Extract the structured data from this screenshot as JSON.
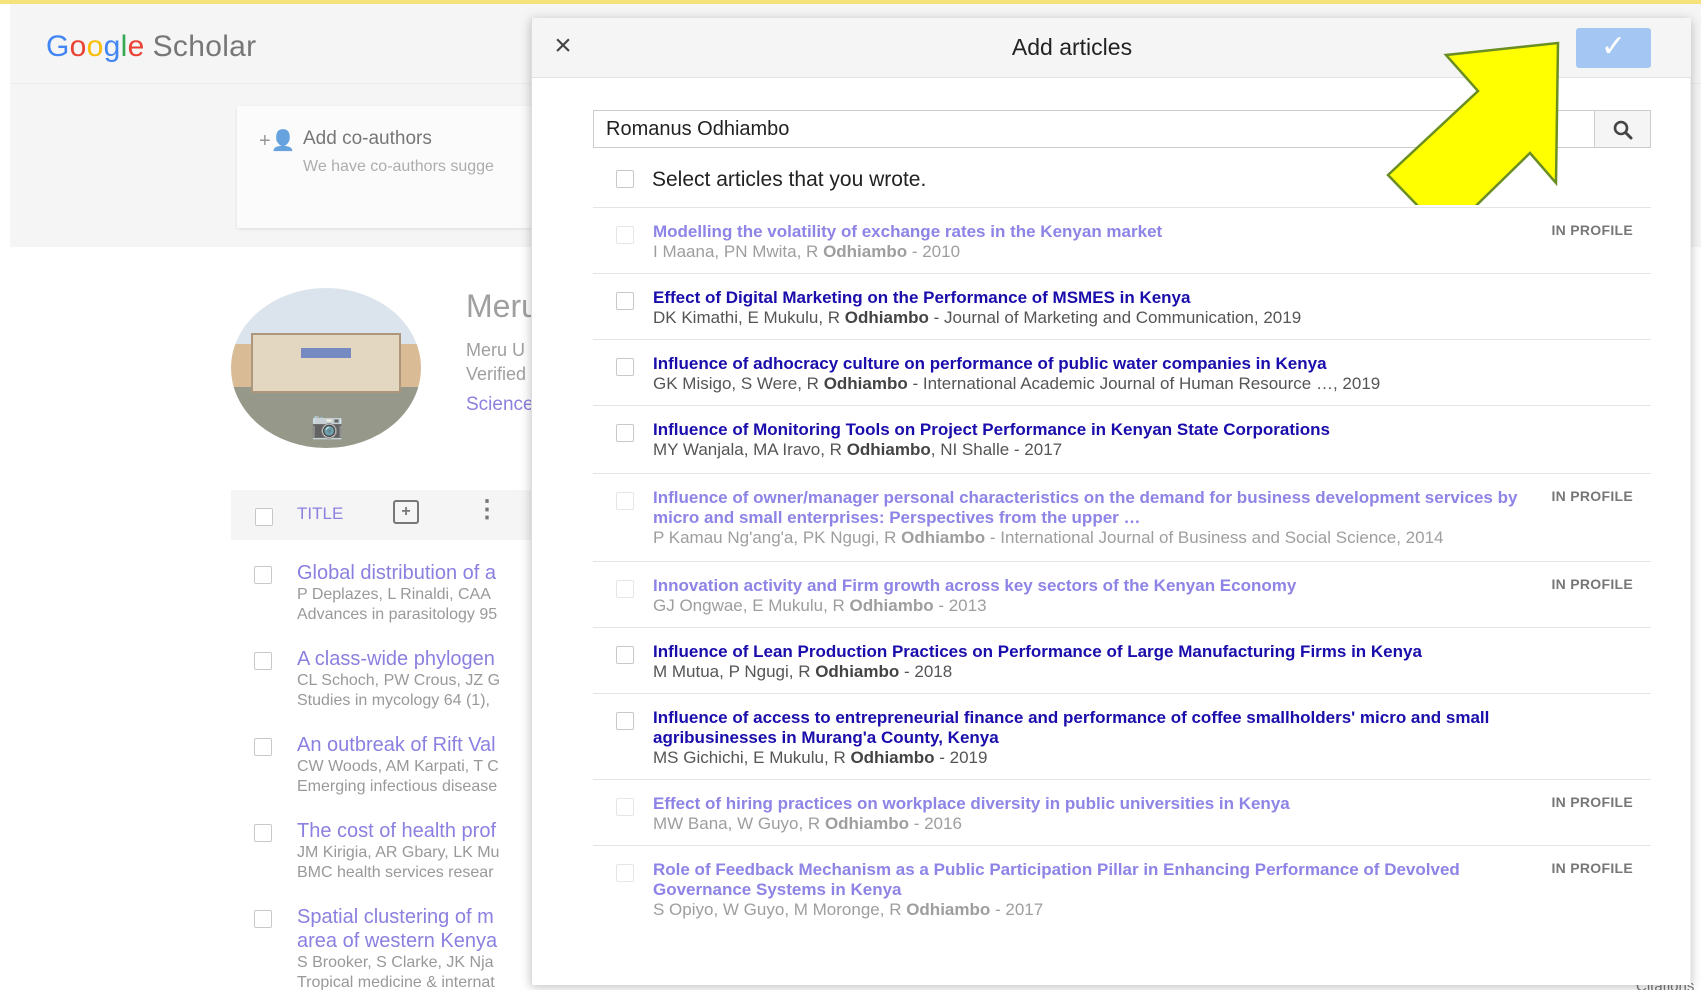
{
  "background": {
    "logo_google": "Google",
    "logo_scholar": "Scholar",
    "coauthors": {
      "title": "Add co-authors",
      "subtitle": "We have co-authors sugge"
    },
    "profile": {
      "name": "Meru",
      "line1": "Meru U",
      "line2": "Verified",
      "link": "Science"
    },
    "table_header": {
      "title_label": "TITLE"
    },
    "articles": [
      {
        "title": "Global distribution of a",
        "authors": "P Deplazes, L Rinaldi, CAA",
        "venue": "Advances in parasitology 95"
      },
      {
        "title": "A class-wide phylogen",
        "authors": "CL Schoch, PW Crous, JZ G",
        "venue": "Studies in mycology 64 (1),"
      },
      {
        "title": "An outbreak of Rift Val",
        "authors": "CW Woods, AM Karpati, T C",
        "venue": "Emerging infectious disease"
      },
      {
        "title": "The cost of health prof",
        "authors": "JM Kirigia, AR Gbary, LK Mu",
        "venue": "BMC health services resear"
      },
      {
        "title": "Spatial clustering of m",
        "title2": "area of western Kenya",
        "authors": "S Brooker, S Clarke, JK Nja",
        "venue": "Tropical medicine & internat"
      }
    ],
    "bottom_right": "Citations"
  },
  "modal": {
    "title": "Add articles",
    "search": {
      "value": "Romanus Odhiambo"
    },
    "select_label": "Select articles that you wrote.",
    "in_profile_label": "IN PROFILE",
    "rows": [
      {
        "title": "Modelling the volatility of exchange rates in the Kenyan market",
        "pre": "I Maana, PN Mwita, R ",
        "bold": "Odhiambo",
        "post": " - 2010",
        "in_profile": true
      },
      {
        "title": "Effect of Digital Marketing on the Performance of MSMES in Kenya",
        "pre": "DK Kimathi, E Mukulu, R ",
        "bold": "Odhiambo",
        "post": " - Journal of Marketing and Communication, 2019",
        "in_profile": false
      },
      {
        "title": "Influence of adhocracy culture on performance of public water companies in Kenya",
        "pre": "GK Misigo, S Were, R ",
        "bold": "Odhiambo",
        "post": " - International Academic Journal of Human Resource …, 2019",
        "in_profile": false
      },
      {
        "title": "Influence of Monitoring Tools on Project Performance in Kenyan State Corporations",
        "pre": "MY Wanjala, MA Iravo, R ",
        "bold": "Odhiambo",
        "post": ", NI Shalle - 2017",
        "in_profile": false
      },
      {
        "title": "Influence of owner/manager personal characteristics on the demand for business development services by micro and small enterprises: Perspectives from the upper …",
        "pre": "P Kamau Ng'ang'a, PK Ngugi, R ",
        "bold": "Odhiambo",
        "post": " - International Journal of Business and Social Science, 2014",
        "in_profile": true
      },
      {
        "title": "Innovation activity and Firm growth across key sectors of the Kenyan Economy",
        "pre": "GJ Ongwae, E Mukulu, R ",
        "bold": "Odhiambo",
        "post": " - 2013",
        "in_profile": true
      },
      {
        "title": "Influence of Lean Production Practices on Performance of Large Manufacturing Firms in Kenya",
        "pre": "M Mutua, P Ngugi, R ",
        "bold": "Odhiambo",
        "post": " - 2018",
        "in_profile": false
      },
      {
        "title": "Influence of access to entrepreneurial finance and performance of coffee smallholders' micro and small agribusinesses in Murang'a County, Kenya",
        "pre": "MS Gichichi, E Mukulu, R ",
        "bold": "Odhiambo",
        "post": " - 2019",
        "in_profile": false
      },
      {
        "title": "Effect of hiring practices on workplace diversity in public universities in Kenya",
        "pre": "MW Bana, W Guyo, R ",
        "bold": "Odhiambo",
        "post": " - 2016",
        "in_profile": true
      },
      {
        "title": "Role of Feedback Mechanism as a Public Participation Pillar in Enhancing Performance of Devolved Governance Systems in Kenya",
        "pre": "S Opiyo, W Guyo, M Moronge, R ",
        "bold": "Odhiambo",
        "post": " - 2017",
        "in_profile": true
      }
    ]
  },
  "colors": {
    "link": "#1a0dab",
    "link_muted": "#8d84e6",
    "confirm": "#a4c6f3",
    "arrow": "#ffff00",
    "arrow_outline": "#6b8e23"
  },
  "icons": [
    "close-icon",
    "checkmark-icon",
    "search-icon",
    "add-person-icon",
    "camera-icon",
    "add-box-icon",
    "more-vert-icon",
    "pointer-arrow"
  ]
}
